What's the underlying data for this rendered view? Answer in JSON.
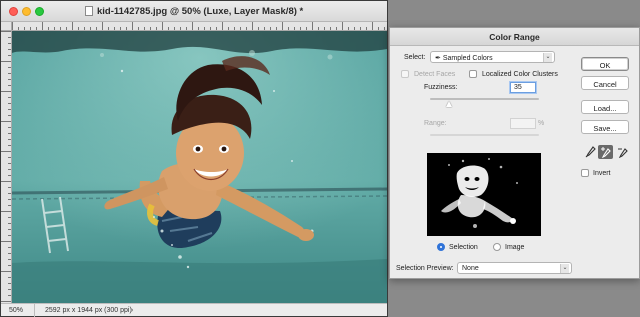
{
  "document": {
    "title": "kid-1142785.jpg @ 50% (Luxe, Layer Mask/8) *",
    "zoom": "50%",
    "info": "2592 px x 1944 px (300 ppi)",
    "status_arrow": "›"
  },
  "dialog": {
    "title": "Color Range",
    "select_label": "Select:",
    "select_value": "Sampled Colors",
    "detect_faces_label": "Detect Faces",
    "localized_label": "Localized Color Clusters",
    "fuzziness_label": "Fuzziness:",
    "fuzziness_value": "35",
    "fuzziness_level": 0.17,
    "range_label": "Range:",
    "range_unit": "%",
    "selection_label": "Selection",
    "image_label": "Image",
    "preview_label": "Selection Preview:",
    "preview_value": "None",
    "buttons": {
      "ok": "OK",
      "cancel": "Cancel",
      "load": "Load...",
      "save": "Save..."
    },
    "invert_label": "Invert",
    "chevron_glyph": "⌄"
  },
  "colors": {
    "accent": "#2f73d8",
    "pool": "#5aa6a3",
    "dialog_bg": "#ececec"
  },
  "icons": [
    "eyedropper-icon",
    "eyedropper-plus-icon",
    "eyedropper-minus-icon"
  ]
}
